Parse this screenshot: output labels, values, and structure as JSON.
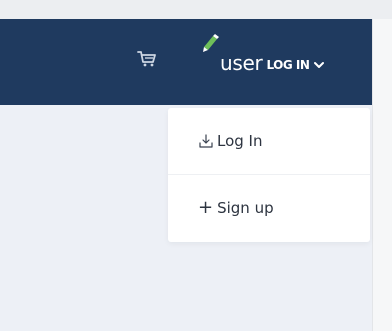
{
  "header": {
    "username": "user",
    "login_label": "LOG IN",
    "icons": {
      "cart": "shopping-cart-icon",
      "user": "user-avatar-icon",
      "dropdown": "chevron-down-icon"
    }
  },
  "dropdown": {
    "items": [
      {
        "label": "Log In",
        "icon": "login-download-icon"
      },
      {
        "label": "Sign up",
        "icon": "plus-icon",
        "glyph": "+"
      }
    ]
  },
  "colors": {
    "navbar": "#1f3a5f",
    "page_background": "#edf0f6",
    "menu_text": "#2d3440",
    "user_icon_accent": "#6fbf5a"
  }
}
